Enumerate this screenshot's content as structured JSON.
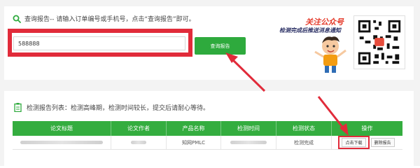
{
  "query": {
    "heading": "查询报告-- 请输入订单编号或手机号，点击“查询报告”即可。",
    "input_value": "588888",
    "button_label": "查询报告"
  },
  "promo": {
    "title": "关注公众号",
    "subtitle": "检测完成后推送消息通知"
  },
  "list": {
    "heading": "检测报告列表：检测高峰期，检测时间较长，提交后请耐心等待。",
    "columns": [
      "论文标题",
      "论文作者",
      "产品名称",
      "检测时间",
      "检测状态",
      "操作"
    ],
    "rows": [
      {
        "product": "知网PMLC",
        "status": "检测完成",
        "download_label": "点击下载",
        "delete_label": "删除报告"
      }
    ]
  },
  "colors": {
    "green": "#2eaa3d",
    "red": "#e12b3a",
    "promo_red": "#e53a2a",
    "promo_navy": "#2a2f64"
  }
}
